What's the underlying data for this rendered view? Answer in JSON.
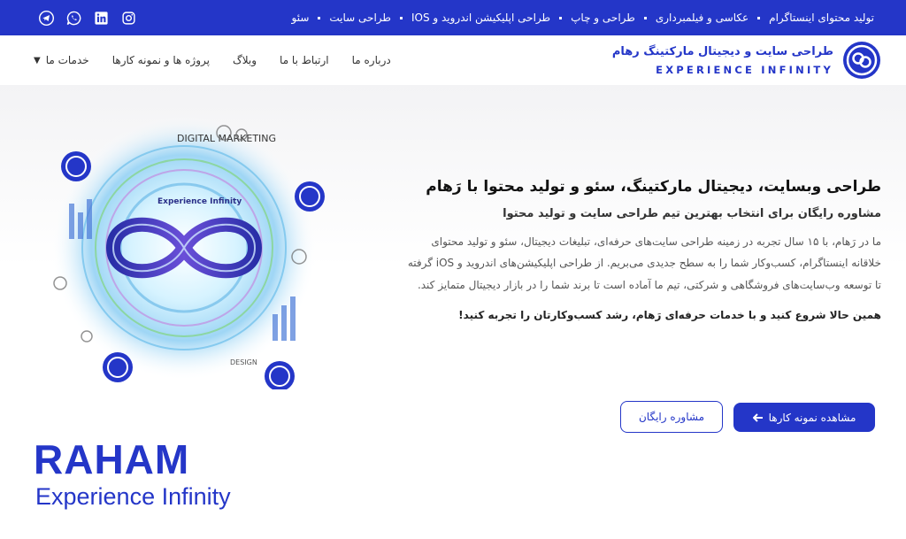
{
  "colors": {
    "primary": "#2436c8",
    "white": "#ffffff",
    "text": "#222222",
    "muted": "#555555"
  },
  "topbar": {
    "links": [
      {
        "label": "سئو"
      },
      {
        "label": "طراحی سایت"
      },
      {
        "label": "طراحی اپلیکیشن اندروید و IOS"
      },
      {
        "label": "طراحی و چاپ"
      },
      {
        "label": "عکاسی و فیلمبرداری"
      },
      {
        "label": "تولید محتوای اینستاگرام"
      }
    ],
    "social": [
      "telegram-icon",
      "whatsapp-icon",
      "linkedin-icon",
      "instagram-icon"
    ]
  },
  "header": {
    "logo_title": "طراحی سایت و دیجیتال مارکتینگ رهام",
    "logo_subtitle": "EXPERIENCE INFINITY",
    "nav": {
      "services": "خدمات ما",
      "projects": "پروژه ها و نمونه کارها",
      "blog": "وبلاگ",
      "contact": "ارتباط با ما",
      "about": "درباره ما"
    }
  },
  "hero": {
    "art_text_1": "DIGITAL MARKETING",
    "art_text_2": "Experience Infinity",
    "art_text_3": "DESIGN",
    "brand_big": "RAHAM",
    "brand_small": "Experience Infinity",
    "title": "طراحی وبسایت، دیجیتال مارکتینگ، سئو و تولید محتوا با رَهام",
    "subtitle": "مشاوره رایگان برای انتخاب بهترین تیم طراحی سایت و تولید محتوا",
    "paragraph": "ما در رَهام، با ۱۵ سال تجربه در زمینه طراحی سایت‌های حرفه‌ای، تبلیغات دیجیتال، سئو و تولید محتوای خلاقانه اینستاگرام، کسب‌وکار شما را به سطح جدیدی می‌بریم. از طراحی اپلیکیشن‌های اندروید و iOS گرفته تا توسعه وب‌سایت‌های فروشگاهی و شرکتی، تیم ما آماده است تا برند شما را در بازار دیجیتال متمایز کند.",
    "cta": "همین حالا شروع کنید و با خدمات حرفه‌ای رَهام، رشد کسب‌وکارتان را تجربه کنید!",
    "primary_button": "مشاهده نمونه کارها",
    "outline_button": "مشاوره رایگان"
  }
}
